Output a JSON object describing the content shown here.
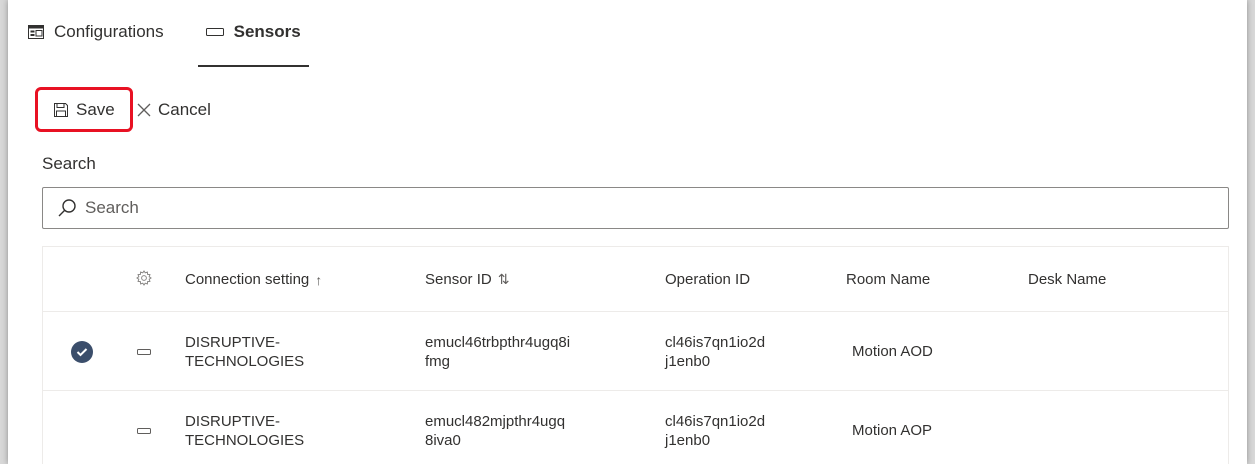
{
  "tabs": [
    {
      "label": "Configurations",
      "icon": "configurations-icon",
      "active": false
    },
    {
      "label": "Sensors",
      "icon": "sensor-icon",
      "active": true
    }
  ],
  "toolbar": {
    "save_label": "Save",
    "cancel_label": "Cancel"
  },
  "search": {
    "label": "Search",
    "placeholder": "Search",
    "value": ""
  },
  "grid": {
    "columns": {
      "settings_icon": "gear-icon",
      "connection_setting": "Connection setting",
      "connection_sort": "↑",
      "sensor_id": "Sensor ID",
      "sensor_sort": "⇅",
      "operation_id": "Operation ID",
      "room_name": "Room Name",
      "desk_name": "Desk Name"
    },
    "rows": [
      {
        "selected": true,
        "connection_setting_line1": "DISRUPTIVE-",
        "connection_setting_line2": "TECHNOLOGIES",
        "sensor_id_line1": "emucl46trbpthr4ugq8i",
        "sensor_id_line2": "fmg",
        "operation_id_line1": "cl46is7qn1io2d",
        "operation_id_line2": "j1enb0",
        "room_name": "Motion AOD",
        "desk_name": ""
      },
      {
        "selected": false,
        "connection_setting_line1": "DISRUPTIVE-",
        "connection_setting_line2": "TECHNOLOGIES",
        "sensor_id_line1": "emucl482mjpthr4ugq",
        "sensor_id_line2": "8iva0",
        "operation_id_line1": "cl46is7qn1io2d",
        "operation_id_line2": "j1enb0",
        "room_name": "Motion AOP",
        "desk_name": ""
      }
    ]
  },
  "colors": {
    "highlight_border": "#e81123",
    "selected_check": "#3b4e6b",
    "text": "#323130"
  }
}
